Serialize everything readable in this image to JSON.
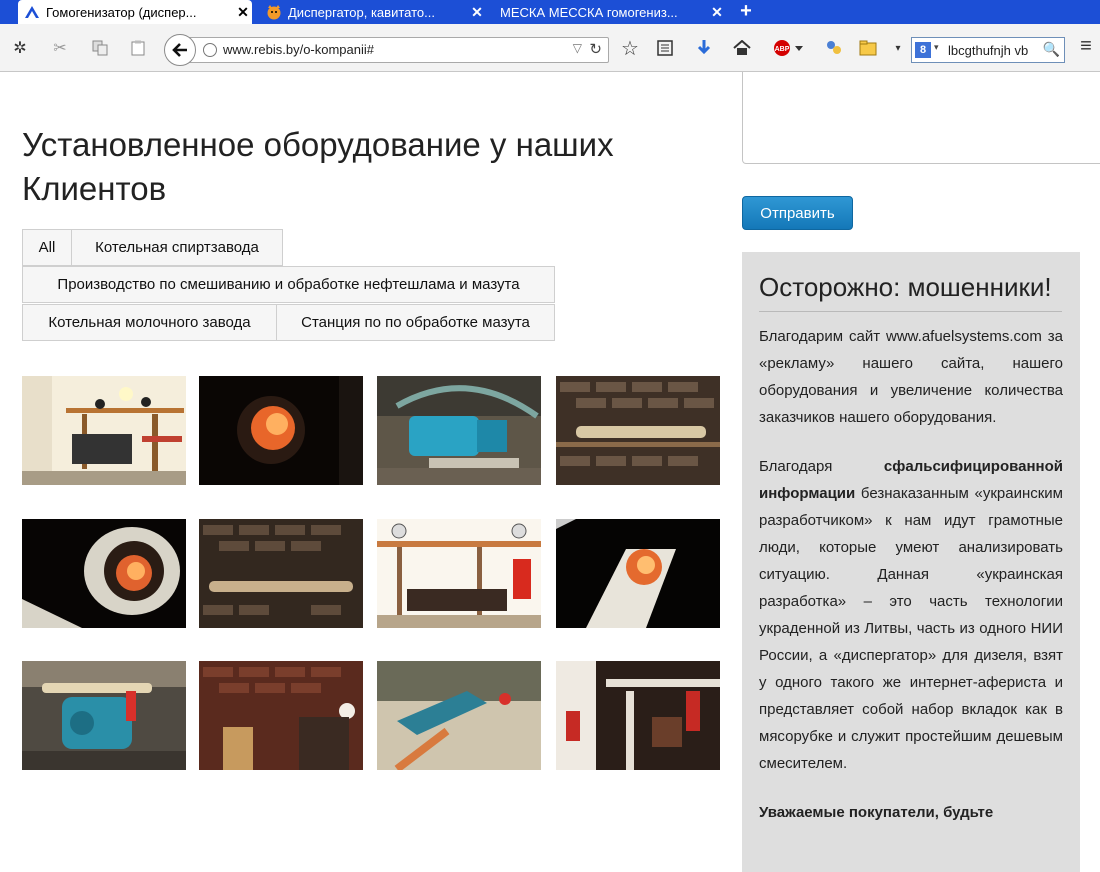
{
  "browser": {
    "tabs": [
      {
        "title": "Гомогенизатор (диспер...",
        "active": true
      },
      {
        "title": "Диспергатор, кавитато...",
        "active": false
      },
      {
        "title": "МЕСКА МЕССКА гомогениз...",
        "active": false
      }
    ],
    "new_tab_symbol": "+",
    "url": "www.rebis.by/o-kompanii#",
    "search_value": "lbcgthufnjh vb"
  },
  "page": {
    "title": "Установленное оборудование у наших Клиентов",
    "filters": [
      "All",
      "Котельная спиртзавода",
      "Производство по смешиванию и обработке нефтешлама и мазута",
      "Котельная молочного завода",
      "Станция по по обработке мазута"
    ],
    "gallery": [
      {
        "scene": "boiler-room-pipes"
      },
      {
        "scene": "furnace-flame"
      },
      {
        "scene": "blue-pump"
      },
      {
        "scene": "brick-wall-pipe"
      },
      {
        "scene": "burner-tube"
      },
      {
        "scene": "brick-wall-pipe-2"
      },
      {
        "scene": "valves-rack"
      },
      {
        "scene": "flame-dark"
      },
      {
        "scene": "blue-pump-2"
      },
      {
        "scene": "brick-room"
      },
      {
        "scene": "floor-pump"
      },
      {
        "scene": "white-pipes"
      }
    ]
  },
  "sidebar": {
    "submit_label": "Отправить",
    "heading": "Осторожно: мошенники!",
    "paragraph1": "Благодарим сайт www.afuelsystems.com за «рекламу» нашего сайта, нашего оборудования и увеличение количества заказчиков нашего оборудования.",
    "p2_lead": "Благодаря ",
    "p2_bold": "сфальсифицированной информации",
    "p2_rest": " безнаказанным «украинским разработчиком» к нам идут грамотные люди, которые умеют анализировать ситуацию. Данная «украинская разработка» – это часть технологии украденной из Литвы, часть из одного НИИ России, а «диспергатор» для дизеля, взят у одного такого же интернет-афериста и представляет собой набор вкладок как в мясорубке и служит простейшим дешевым смесителем.",
    "p3_bold": "Уважаемые покупатели, будьте"
  }
}
